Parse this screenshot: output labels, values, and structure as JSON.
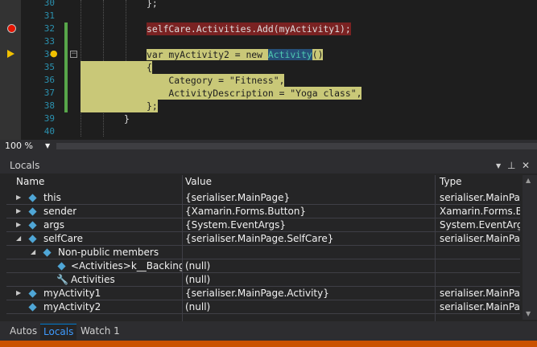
{
  "editor": {
    "line_numbers": [
      "30",
      "31",
      "32",
      "33",
      "34",
      "35",
      "36",
      "37",
      "38",
      "39",
      "40"
    ],
    "code": {
      "l30": "};",
      "l32": "selfCare.Activities.Add(myActivity1);",
      "l34_kw": "var",
      "l34_mid": " myActivity2 = new ",
      "l34_type": "Activity",
      "l34_end": "()",
      "l35": "{",
      "l36": "    Category = \"Fitness\",",
      "l37": "    ActivityDescription = \"Yoga class\",",
      "l38": "};",
      "l39": "}"
    }
  },
  "zoom": {
    "value": "100 %"
  },
  "locals": {
    "title": "Locals",
    "columns": [
      "Name",
      "Value",
      "Type"
    ],
    "rows": [
      {
        "name": "this",
        "value": "{serialiser.MainPage}",
        "type": "serialiser.MainPa..."
      },
      {
        "name": "sender",
        "value": "{Xamarin.Forms.Button}",
        "type": "Xamarin.Forms.B..."
      },
      {
        "name": "args",
        "value": "{System.EventArgs}",
        "type": "System.EventArgs"
      },
      {
        "name": "selfCare",
        "value": "{serialiser.MainPage.SelfCare}",
        "type": "serialiser.MainPa..."
      },
      {
        "name": "Non-public members",
        "value": "",
        "type": ""
      },
      {
        "name": "<Activities>k__BackingF...",
        "value": "(null)",
        "type": ""
      },
      {
        "name": "Activities",
        "value": "(null)",
        "type": ""
      },
      {
        "name": "myActivity1",
        "value": "{serialiser.MainPage.Activity}",
        "type": "serialiser.MainPa..."
      },
      {
        "name": "myActivity2",
        "value": "(null)",
        "type": "serialiser.MainPa..."
      }
    ]
  },
  "tabs": [
    "Autos",
    "Locals",
    "Watch 1"
  ],
  "colors": {
    "accent": "#007acc",
    "statusbar": "#ca5100",
    "breakpoint": "#e51400"
  }
}
